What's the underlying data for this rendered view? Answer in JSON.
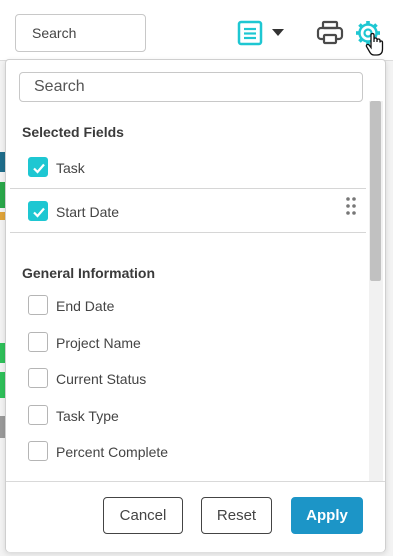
{
  "toolbar": {
    "search_placeholder": "Search",
    "view_icon": "list-view-icon",
    "print_icon": "printer-icon",
    "settings_icon": "gear-icon",
    "accent_color": "#1ec7d2"
  },
  "panel": {
    "search_placeholder": "Search",
    "selected_section_title": "Selected Fields",
    "selected_fields": [
      {
        "label": "Task",
        "checked": true
      },
      {
        "label": "Start Date",
        "checked": true
      }
    ],
    "general_section_title": "General Information",
    "general_fields": [
      {
        "label": "End Date",
        "checked": false
      },
      {
        "label": "Project Name",
        "checked": false
      },
      {
        "label": "Current Status",
        "checked": false
      },
      {
        "label": "Task Type",
        "checked": false
      },
      {
        "label": "Percent Complete",
        "checked": false
      }
    ],
    "buttons": {
      "cancel": "Cancel",
      "reset": "Reset",
      "apply": "Apply"
    },
    "apply_color": "#1c95c7"
  }
}
